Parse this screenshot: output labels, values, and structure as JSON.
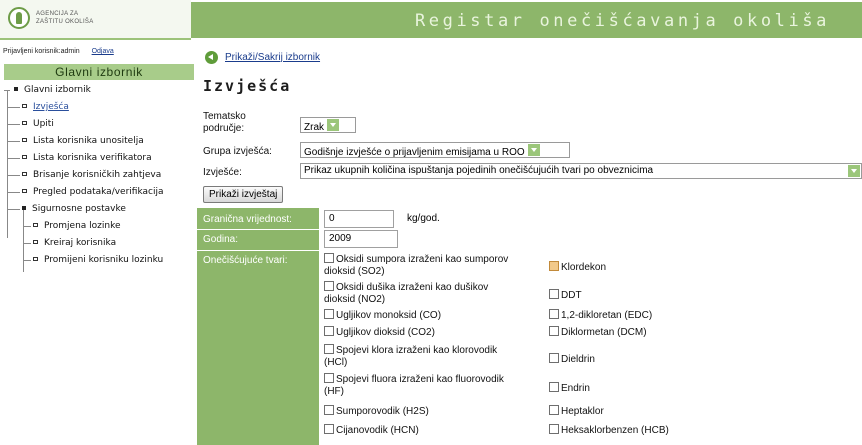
{
  "header": {
    "logo_line1": "AGENCIJA ZA",
    "logo_line2": "ZAŠTITU OKOLIŠA",
    "app_title": "Registar onečišćavanja okoliša"
  },
  "user_bar": {
    "logged_in_label": "Prijavljeni korisnik:admin",
    "logout": "Odjava"
  },
  "sidebar": {
    "menu_title": "Glavni izbornik",
    "items": [
      {
        "label": "Glavni izbornik",
        "level": 0
      },
      {
        "label": "Izvješća",
        "level": 1,
        "active": true
      },
      {
        "label": "Upiti",
        "level": 1
      },
      {
        "label": "Lista korisnika unositelja",
        "level": 1
      },
      {
        "label": "Lista korisnika verifikatora",
        "level": 1
      },
      {
        "label": "Brisanje korisničkih zahtjeva",
        "level": 1
      },
      {
        "label": "Pregled podataka/verifikacija",
        "level": 1
      },
      {
        "label": "Sigurnosne postavke",
        "level": 1
      },
      {
        "label": "Promjena lozinke",
        "level": 2
      },
      {
        "label": "Kreiraj korisnika",
        "level": 2
      },
      {
        "label": "Promijeni korisniku lozinku",
        "level": 2
      }
    ]
  },
  "main": {
    "toggle_link": "Prikaži/Sakrij izbornik",
    "page_title": "Izvješća",
    "form": {
      "thematic_label_1": "Tematsko",
      "thematic_label_2": "područje:",
      "thematic_value": "Zrak",
      "group_label": "Grupa izvješća:",
      "group_value": "Godišnje izvješće o prijavljenim emisijama u ROO",
      "report_label": "Izvješće:",
      "report_value": "Prikaz ukupnih količina ispuštanja pojedinih onečišćujućih tvari po obveznicima",
      "show_button": "Prikaži izvještaj"
    },
    "grid": {
      "threshold_label": "Granična vrijednost:",
      "threshold_value": "0",
      "threshold_unit": "kg/god.",
      "year_label": "Godina:",
      "year_value": "2009",
      "pollutants_label": "Onečišćujuće tvari:",
      "pollutants_left": [
        {
          "l1": "Oksidi sumpora izraženi kao sumporov",
          "l2": "dioksid (SO2)"
        },
        {
          "l1": "Oksidi dušika izraženi kao dušikov",
          "l2": "dioksid (NO2)"
        },
        {
          "l1": "Ugljikov monoksid (CO)",
          "l2": ""
        },
        {
          "l1": "Ugljikov dioksid (CO2)",
          "l2": ""
        },
        {
          "l1": "Spojevi klora izraženi kao klorovodik",
          "l2": "(HCl)"
        },
        {
          "l1": "Spojevi fluora izraženi kao fluorovodik",
          "l2": "(HF)"
        },
        {
          "l1": "Sumporovodik (H2S)",
          "l2": ""
        },
        {
          "l1": "Cijanovodik (HCN)",
          "l2": ""
        }
      ],
      "pollutants_right": [
        "Klordekon",
        "DDT",
        "1,2-dikloretan (EDC)",
        "Diklormetan (DCM)",
        "Dieldrin",
        "Endrin",
        "Heptaklor",
        "Heksaklorbenzen (HCB)"
      ]
    }
  }
}
